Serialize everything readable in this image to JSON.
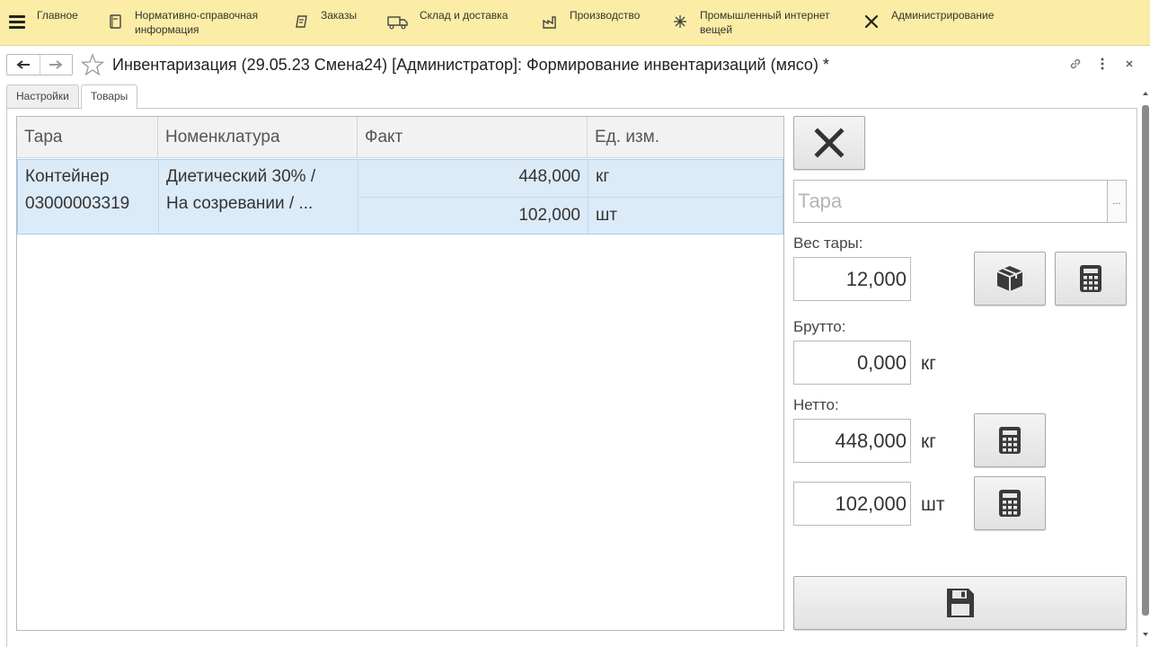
{
  "topbar": {
    "items": [
      {
        "label": "Главное"
      },
      {
        "label": "Нормативно-справочная информация"
      },
      {
        "label": "Заказы"
      },
      {
        "label": "Склад и доставка"
      },
      {
        "label": "Производство"
      },
      {
        "label": "Промышленный интернет вещей"
      },
      {
        "label": "Администрирование"
      }
    ]
  },
  "window": {
    "title": "Инвентаризация (29.05.23 Смена24) [Администратор]: Формирование инвентаризаций (мясо) *"
  },
  "tabs": [
    {
      "label": "Настройки"
    },
    {
      "label": "Товары"
    }
  ],
  "table": {
    "columns": [
      "Тара",
      "Номенклатура",
      "Факт",
      "Ед. изм."
    ],
    "rows": [
      {
        "tara": [
          "Контейнер",
          "03000003319"
        ],
        "nomenclature": [
          "Диетический 30% /",
          "На созревании / ..."
        ],
        "fact": [
          "448,000",
          "102,000"
        ],
        "unit": [
          "кг",
          "шт"
        ]
      }
    ]
  },
  "right_panel": {
    "tara_placeholder": "Тара",
    "tara_button_label": "...",
    "tare_weight_label": "Вес тары:",
    "tare_weight_value": "12,000",
    "gross_label": "Брутто:",
    "gross_value": "0,000",
    "gross_unit": "кг",
    "net_label": "Нетто:",
    "net_value_kg": "448,000",
    "net_unit_kg": "кг",
    "net_value_pcs": "102,000",
    "net_unit_pcs": "шт"
  },
  "colors": {
    "topbar": "#fbeda5",
    "selected_row": "#dcebf8",
    "selected_row_border": "#a9cdf0"
  }
}
